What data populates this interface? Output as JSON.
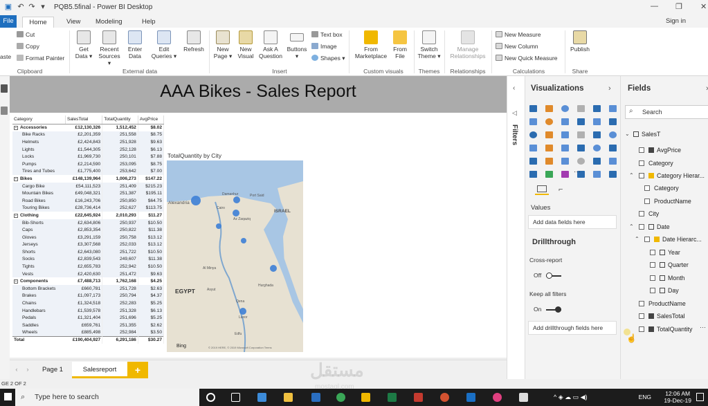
{
  "window": {
    "title": "PQB5.5final - Power BI Desktop"
  },
  "menu": {
    "tabs": [
      {
        "label": "File"
      },
      {
        "label": "Home"
      },
      {
        "label": "View"
      },
      {
        "label": "Modeling"
      },
      {
        "label": "Help"
      }
    ],
    "sign_in": "Sign in"
  },
  "ribbon": {
    "clipboard": {
      "cut": "Cut",
      "copy": "Copy",
      "format_painter": "Format Painter",
      "paste": "aste",
      "label": "Clipboard"
    },
    "external": {
      "get_data": "Get Data ▾",
      "recent_sources": "Recent Sources ▾",
      "enter_data": "Enter Data",
      "edit_queries": "Edit Queries ▾",
      "refresh": "Refresh",
      "label": "External data"
    },
    "insert": {
      "new_page": "New Page ▾",
      "new_visual": "New Visual",
      "ask_question": "Ask A Question",
      "buttons": "Buttons ▾",
      "text_box": "Text box",
      "image": "Image",
      "shapes": "Shapes ▾",
      "label": "Insert"
    },
    "custom_visuals": {
      "marketplace": "From Marketplace",
      "file": "From File",
      "label": "Custom visuals"
    },
    "themes": {
      "switch": "Switch Theme ▾",
      "label": "Themes"
    },
    "relationships": {
      "manage": "Manage Relationships",
      "label": "Relationships"
    },
    "calculations": {
      "new_measure": "New Measure",
      "new_column": "New Column",
      "new_quick_measure": "New Quick Measure",
      "label": "Calculations"
    },
    "share": {
      "publish": "Publish",
      "label": "Share"
    }
  },
  "report": {
    "banner_title": "AAA Bikes - Sales Report",
    "matrix": {
      "headers": [
        "Category",
        "SalesTotal",
        "TotalQuantity",
        "AvgPrice"
      ],
      "rows": [
        {
          "type": "cat",
          "name": "Accessories",
          "sales": "£12,130,326",
          "qty": "1,512,452",
          "avg": "$8.02"
        },
        {
          "type": "sub",
          "name": "Bike Racks",
          "sales": "£2,201,359",
          "qty": "251,558",
          "avg": "$8.75"
        },
        {
          "type": "sub",
          "name": "Helmets",
          "sales": "£2,424,843",
          "qty": "251,928",
          "avg": "$9.63"
        },
        {
          "type": "sub",
          "name": "Lights",
          "sales": "£1,544,305",
          "qty": "252,128",
          "avg": "$6.13"
        },
        {
          "type": "sub",
          "name": "Locks",
          "sales": "£1,969,730",
          "qty": "250,101",
          "avg": "$7.88"
        },
        {
          "type": "sub",
          "name": "Pumps",
          "sales": "£2,214,590",
          "qty": "253,095",
          "avg": "$8.75"
        },
        {
          "type": "sub",
          "name": "Tires and Tubes",
          "sales": "£1,775,400",
          "qty": "253,642",
          "avg": "$7.00"
        },
        {
          "type": "cat",
          "name": "Bikes",
          "sales": "£148,139,964",
          "qty": "1,006,273",
          "avg": "$147.22"
        },
        {
          "type": "sub",
          "name": "Cargo Bike",
          "sales": "£54,111,523",
          "qty": "251,409",
          "avg": "$215.23"
        },
        {
          "type": "sub",
          "name": "Mountain Bikes",
          "sales": "£49,048,321",
          "qty": "251,387",
          "avg": "$195.11"
        },
        {
          "type": "sub",
          "name": "Road Bikes",
          "sales": "£16,243,706",
          "qty": "250,850",
          "avg": "$64.75"
        },
        {
          "type": "sub",
          "name": "Touring Bikes",
          "sales": "£28,736,414",
          "qty": "252,627",
          "avg": "$113.75"
        },
        {
          "type": "cat",
          "name": "Clothing",
          "sales": "£22,645,924",
          "qty": "2,010,293",
          "avg": "$11.27"
        },
        {
          "type": "sub",
          "name": "Bib-Shorts",
          "sales": "£2,634,806",
          "qty": "250,937",
          "avg": "$10.50"
        },
        {
          "type": "sub",
          "name": "Caps",
          "sales": "£2,853,354",
          "qty": "250,822",
          "avg": "$11.38"
        },
        {
          "type": "sub",
          "name": "Gloves",
          "sales": "£3,291,159",
          "qty": "250,758",
          "avg": "$13.12"
        },
        {
          "type": "sub",
          "name": "Jerseys",
          "sales": "£3,307,568",
          "qty": "252,033",
          "avg": "$13.12"
        },
        {
          "type": "sub",
          "name": "Shorts",
          "sales": "£2,643,080",
          "qty": "251,722",
          "avg": "$10.50"
        },
        {
          "type": "sub",
          "name": "Socks",
          "sales": "£2,839,543",
          "qty": "249,607",
          "avg": "$11.38"
        },
        {
          "type": "sub",
          "name": "Tights",
          "sales": "£2,655,783",
          "qty": "252,942",
          "avg": "$10.50"
        },
        {
          "type": "sub",
          "name": "Vests",
          "sales": "£2,420,630",
          "qty": "251,472",
          "avg": "$9.63"
        },
        {
          "type": "cat",
          "name": "Components",
          "sales": "£7,488,713",
          "qty": "1,762,168",
          "avg": "$4.25"
        },
        {
          "type": "sub",
          "name": "Bottom Brackets",
          "sales": "£660,781",
          "qty": "251,728",
          "avg": "$2.63"
        },
        {
          "type": "sub",
          "name": "Brakes",
          "sales": "£1,097,173",
          "qty": "250,794",
          "avg": "$4.37"
        },
        {
          "type": "sub",
          "name": "Chains",
          "sales": "£1,324,518",
          "qty": "252,283",
          "avg": "$5.25"
        },
        {
          "type": "sub",
          "name": "Handlebars",
          "sales": "£1,539,578",
          "qty": "251,328",
          "avg": "$6.13"
        },
        {
          "type": "sub",
          "name": "Pedals",
          "sales": "£1,321,404",
          "qty": "251,696",
          "avg": "$5.25"
        },
        {
          "type": "sub",
          "name": "Saddles",
          "sales": "£659,761",
          "qty": "251,355",
          "avg": "$2.62"
        },
        {
          "type": "sub",
          "name": "Wheels",
          "sales": "£885,498",
          "qty": "252,984",
          "avg": "$3.50"
        },
        {
          "type": "tot",
          "name": "Total",
          "sales": "£190,404,927",
          "qty": "6,291,186",
          "avg": "$30.27"
        }
      ]
    },
    "map": {
      "title": "TotalQuantity by City",
      "country": "EGYPT",
      "region": "ISRAEL",
      "places": [
        "Alexandria",
        "Damanhur",
        "Cairo",
        "Az Zaqaziq",
        "Port Said",
        "Al Minya",
        "Asyut",
        "Hurghada",
        "Qena",
        "Luxor",
        "Edfu"
      ],
      "attribution": "© 2019 HERE, © 2019 Microsoft Corporation Terms",
      "bing": "Bing"
    }
  },
  "pages": {
    "tabs": [
      "Page 1",
      "Salesreport"
    ],
    "add": "+",
    "status": "GE 2 OF 2"
  },
  "filters": {
    "label": "Filters"
  },
  "visualizations": {
    "title": "Visualizations",
    "values_label": "Values",
    "values_well": "Add data fields here",
    "drillthrough": "Drillthrough",
    "cross_report": "Cross-report",
    "cross_report_state": "Off",
    "keep_filters": "Keep all filters",
    "keep_filters_state": "On",
    "drill_well": "Add drillthrough fields here",
    "more": "···"
  },
  "fields": {
    "title": "Fields",
    "search_placeholder": "Search",
    "table": "SalesT",
    "items": [
      {
        "label": "AvgPrice"
      },
      {
        "label": "Category"
      },
      {
        "label": "Category Hierar..."
      },
      {
        "label": "Category"
      },
      {
        "label": "ProductName"
      },
      {
        "label": "City"
      },
      {
        "label": "Date"
      },
      {
        "label": "Date Hierarc..."
      },
      {
        "label": "Year"
      },
      {
        "label": "Quarter"
      },
      {
        "label": "Month"
      },
      {
        "label": "Day"
      },
      {
        "label": "ProductName"
      },
      {
        "label": "SalesTotal"
      },
      {
        "label": "TotalQuantity"
      }
    ],
    "more": "···"
  },
  "taskbar": {
    "search_placeholder": "Type here to search",
    "lang": "ENG",
    "time": "12:06 AM",
    "date": "19-Dec-19"
  },
  "watermark": {
    "text": "مستقل",
    "sub": "mostaql.com"
  },
  "colors": {
    "accent": "#1f6fbf",
    "banner": "#ababab",
    "page_tab_add": "#f0b800",
    "map_water": "#a8c6e4",
    "map_land": "#e7e1d2",
    "map_bubble": "#3d7fd6"
  }
}
